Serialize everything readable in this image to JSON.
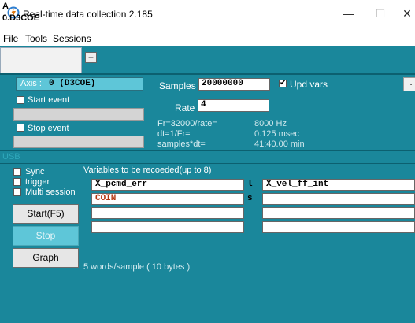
{
  "window": {
    "title": "Real-time data collection 2.185",
    "controls": {
      "minimize": "—",
      "maximize": "☐",
      "close": "✕"
    }
  },
  "menu": {
    "items": [
      "File",
      "Tools",
      "Sessions"
    ]
  },
  "tabs": {
    "active": {
      "letter": "A",
      "name": "0.D3COE"
    },
    "add_label": "+"
  },
  "axis": {
    "label": "Axis :",
    "value": "0 (D3COE)"
  },
  "start_event": {
    "label": "Start event",
    "checked": false,
    "value": ""
  },
  "stop_event": {
    "label": "Stop event",
    "checked": false,
    "value": ""
  },
  "samples": {
    "label": "Samples",
    "value": "20000000"
  },
  "upd_vars": {
    "label": "Upd vars",
    "checked": true
  },
  "more_button": ".",
  "rate": {
    "label": "Rate",
    "value": "4"
  },
  "info": [
    {
      "label": "Fr=32000/rate=",
      "value": "8000 Hz"
    },
    {
      "label": "dt=1/Fr=",
      "value": "0.125 msec"
    },
    {
      "label": "samples*dt=",
      "value": "41:40.00 min"
    }
  ],
  "usb_label": "USB",
  "options": [
    {
      "label": "Sync",
      "checked": false
    },
    {
      "label": "trigger",
      "checked": false
    },
    {
      "label": "Multi session",
      "checked": false
    }
  ],
  "buttons": {
    "start": "Start(F5)",
    "stop": "Stop",
    "graph": "Graph"
  },
  "variables": {
    "title": "Variables to be recoeded(up to 8)",
    "left": [
      "X_pcmd_err",
      "COIN",
      "",
      ""
    ],
    "right": [
      "X_vel_ff_int",
      "",
      "",
      ""
    ],
    "gap_marks": [
      "l",
      "s",
      "",
      ""
    ]
  },
  "words_per_sample": "5 words/sample ( 10 bytes )",
  "colors": {
    "panel": "#1a879b",
    "accent": "#5ec6d8",
    "highlight_text": "#b5350f"
  },
  "icons": [
    "app-icon",
    "checkbox-icon"
  ]
}
